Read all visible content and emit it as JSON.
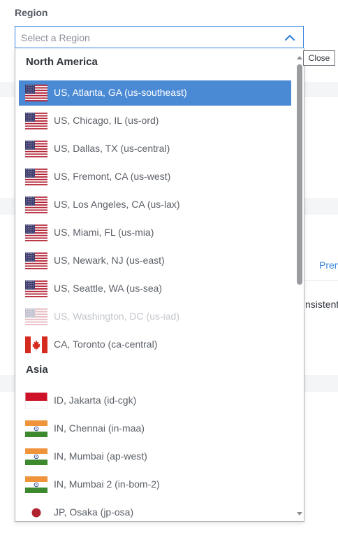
{
  "region": {
    "label": "Region",
    "placeholder": "Select a Region",
    "close_tooltip": "Close"
  },
  "background": {
    "tab_fragment": "Prem",
    "text_fragment": "nsistent"
  },
  "groups": [
    {
      "heading": "North America",
      "options": [
        {
          "label": "US, Atlanta, GA (us-southeast)",
          "flag": "us-flag",
          "selected": true,
          "disabled": false
        },
        {
          "label": "US, Chicago, IL (us-ord)",
          "flag": "us-flag",
          "selected": false,
          "disabled": false
        },
        {
          "label": "US, Dallas, TX (us-central)",
          "flag": "us-flag",
          "selected": false,
          "disabled": false
        },
        {
          "label": "US, Fremont, CA (us-west)",
          "flag": "us-flag",
          "selected": false,
          "disabled": false
        },
        {
          "label": "US, Los Angeles, CA (us-lax)",
          "flag": "us-flag",
          "selected": false,
          "disabled": false
        },
        {
          "label": "US, Miami, FL (us-mia)",
          "flag": "us-flag",
          "selected": false,
          "disabled": false
        },
        {
          "label": "US, Newark, NJ (us-east)",
          "flag": "us-flag",
          "selected": false,
          "disabled": false
        },
        {
          "label": "US, Seattle, WA (us-sea)",
          "flag": "us-flag",
          "selected": false,
          "disabled": false
        },
        {
          "label": "US, Washington, DC (us-iad)",
          "flag": "us-flag",
          "selected": false,
          "disabled": true
        },
        {
          "label": "CA, Toronto (ca-central)",
          "flag": "ca-flag",
          "selected": false,
          "disabled": false
        }
      ]
    },
    {
      "heading": "Asia",
      "options": [
        {
          "label": "ID, Jakarta (id-cgk)",
          "flag": "id-flag",
          "selected": false,
          "disabled": false
        },
        {
          "label": "IN, Chennai (in-maa)",
          "flag": "in-flag",
          "selected": false,
          "disabled": false
        },
        {
          "label": "IN, Mumbai (ap-west)",
          "flag": "in-flag",
          "selected": false,
          "disabled": false
        },
        {
          "label": "IN, Mumbai 2 (in-bom-2)",
          "flag": "in-flag",
          "selected": false,
          "disabled": false
        },
        {
          "label": "JP, Osaka (jp-osa)",
          "flag": "jp-flag",
          "selected": false,
          "disabled": false
        }
      ]
    }
  ],
  "colors": {
    "accent": "#3683dc",
    "selected_bg": "#4a89d4",
    "disabled_text": "#c3c6cb"
  }
}
